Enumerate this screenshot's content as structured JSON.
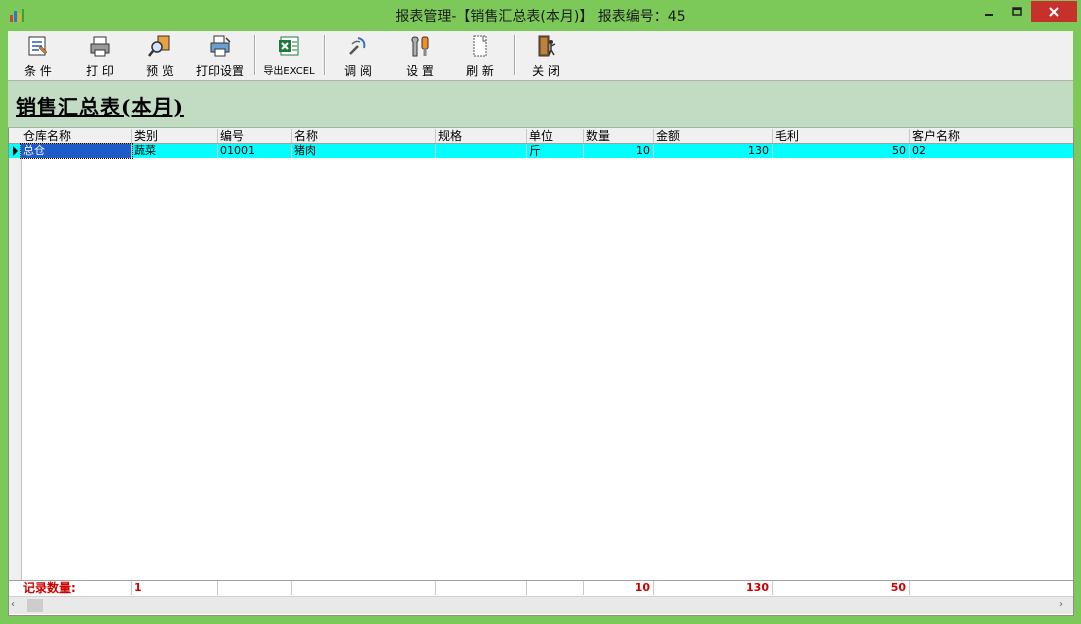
{
  "window": {
    "title": "报表管理-【销售汇总表(本月)】 报表编号：45",
    "controls": {
      "minimize_icon": "minimize-icon",
      "maximize_icon": "maximize-icon",
      "close_icon": "close-icon"
    },
    "accent_color": "#7cc95a",
    "close_color": "#c7312b"
  },
  "toolbar": {
    "items": [
      {
        "label": "条 件",
        "icon": "filter-icon"
      },
      {
        "label": "打 印",
        "icon": "printer-icon"
      },
      {
        "label": "预 览",
        "icon": "preview-icon"
      },
      {
        "label": "打印设置",
        "icon": "print-settings-icon"
      },
      {
        "label": "导出EXCEL",
        "icon": "excel-icon"
      },
      {
        "label": "调 阅",
        "icon": "review-icon"
      },
      {
        "label": "设 置",
        "icon": "settings-icon"
      },
      {
        "label": "刷 新",
        "icon": "refresh-icon"
      },
      {
        "label": "关 闭",
        "icon": "exit-icon"
      }
    ]
  },
  "report": {
    "title": "销售汇总表(本月)",
    "banner_color": "#c1dcc3"
  },
  "table": {
    "columns": [
      "仓库名称",
      "类别",
      "编号",
      "名称",
      "规格",
      "单位",
      "数量",
      "金额",
      "毛利",
      "客户名称"
    ],
    "rows": [
      {
        "warehouse": "总仓",
        "category": "蔬菜",
        "code": "01001",
        "name": "猪肉",
        "spec": "",
        "unit": "斤",
        "qty": "10",
        "amount": "130",
        "profit": "50",
        "customer": "02"
      }
    ],
    "selected_row_color": "#00ffff",
    "footer": {
      "label": "记录数量:",
      "count": "1",
      "qty": "10",
      "amount": "130",
      "profit": "50"
    }
  }
}
